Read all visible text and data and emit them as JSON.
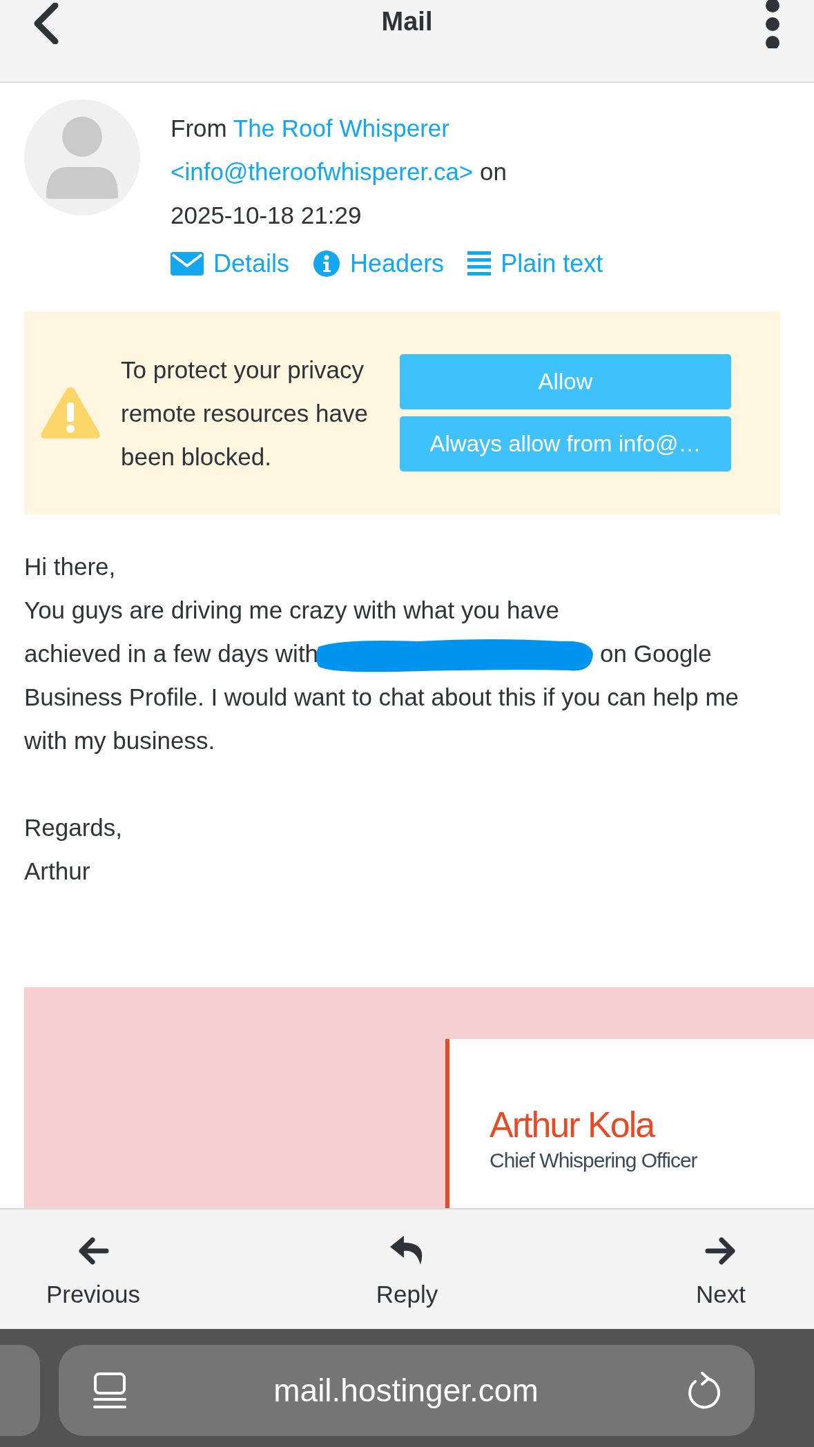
{
  "header": {
    "title": "Mail"
  },
  "message": {
    "from_label": "From",
    "sender_name": "The Roof Whisperer",
    "sender_email": "<info@theroofwhisperer.ca>",
    "on_label": "on",
    "date": "2025-10-18 21:29",
    "links": [
      {
        "kind": "envelope",
        "label": "Details"
      },
      {
        "kind": "info",
        "label": "Headers"
      },
      {
        "kind": "lines",
        "label": "Plain text"
      }
    ]
  },
  "privacy_notice": {
    "text": "To protect your privacy remote resources have been blocked.",
    "buttons": [
      "Allow",
      "Always allow from info@…"
    ]
  },
  "body": {
    "greeting": "Hi there,",
    "paragraph_lines": [
      "You guys are driving me crazy with what you have",
      "achieved in a few days with",
      "on Google",
      "Business Profile. I would want to chat about this if you can help me with my business."
    ],
    "closing": "Regards,",
    "name": "Arthur"
  },
  "signature": {
    "name": "Arthur Kola",
    "title": "Chief Whispering Officer"
  },
  "toolbar": [
    {
      "kind": "previous",
      "label": "Previous"
    },
    {
      "kind": "reply",
      "label": "Reply"
    },
    {
      "kind": "next",
      "label": "Next"
    }
  ],
  "browser": {
    "url": "mail.hostinger.com"
  }
}
